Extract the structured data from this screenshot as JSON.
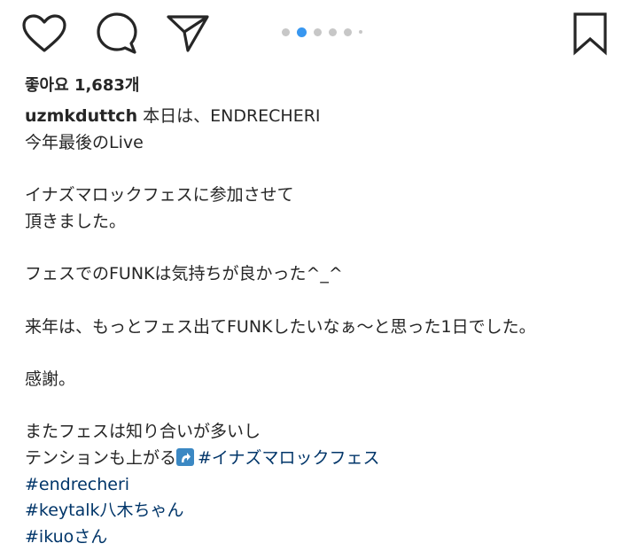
{
  "actions": {
    "like_icon": "heart-icon",
    "comment_icon": "comment-icon",
    "share_icon": "share-icon",
    "save_icon": "bookmark-icon"
  },
  "carousel": {
    "total_visible": 5,
    "active_index": 1,
    "active_color": "#3897f0",
    "inactive_color": "#c7c7c7"
  },
  "likes": {
    "text": "좋아요 1,683개"
  },
  "caption": {
    "username": "uzmkduttch",
    "first_line": "本日は、ENDRECHERI",
    "lines": [
      "今年最後のLive",
      "",
      "イナズマロックフェスに参加させて",
      "頂きました。",
      "",
      "フェスでのFUNKは気持ちが良かった^_^",
      "",
      "来年は、もっとフェス出てFUNKしたいなぁ〜と思った1日でした。",
      "",
      "感謝。",
      "",
      "またフェスは知り合いが多いし"
    ],
    "tension_line": "テンションも上がる",
    "emoji": "up-arrow-emoji",
    "hashtags": [
      "#イナズマロックフェス",
      "#endrecheri",
      "#keytalk八木ちゃん",
      "#ikuoさん"
    ],
    "hashtag_color": "#003569"
  }
}
